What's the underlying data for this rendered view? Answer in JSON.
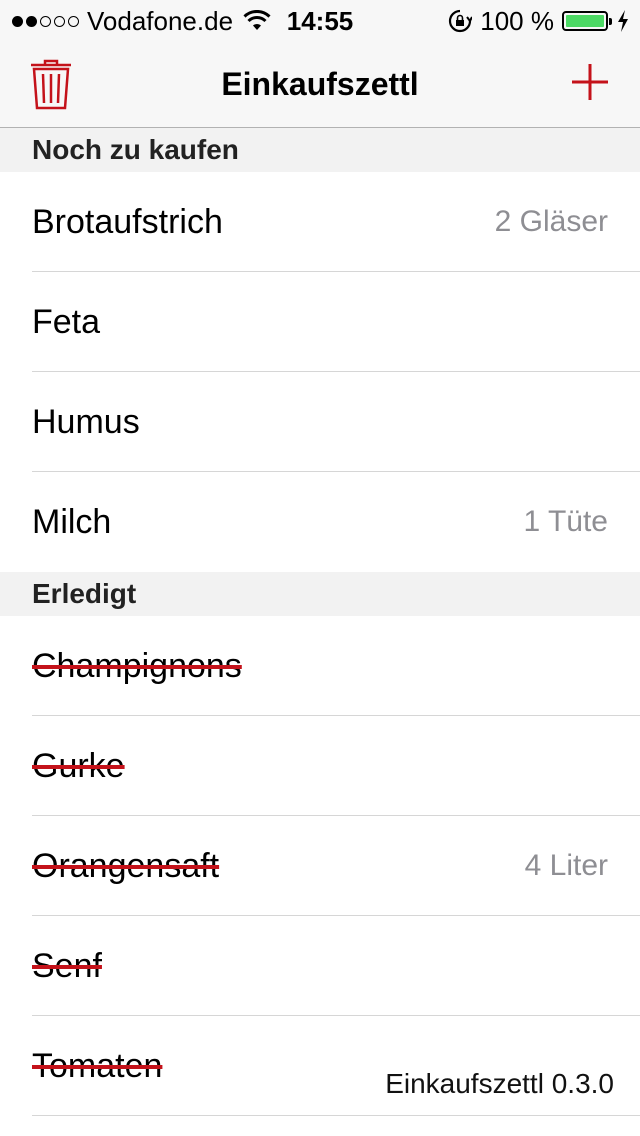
{
  "status_bar": {
    "carrier": "Vodafone.de",
    "signal_bars_filled": 2,
    "signal_bars_total": 5,
    "time": "14:55",
    "battery_percent": "100 %",
    "battery_level": 1.0,
    "battery_color": "#4cd964"
  },
  "navbar": {
    "title": "Einkaufszettl",
    "left_icon": "trash-icon",
    "right_icon": "plus-icon",
    "accent_color": "#c4121a"
  },
  "sections": {
    "pending": {
      "header": "Noch zu kaufen",
      "items": [
        {
          "name": "Brotaufstrich",
          "qty": "2 Gläser"
        },
        {
          "name": "Feta",
          "qty": ""
        },
        {
          "name": "Humus",
          "qty": ""
        },
        {
          "name": "Milch",
          "qty": "1 Tüte"
        }
      ]
    },
    "done": {
      "header": "Erledigt",
      "items": [
        {
          "name": "Champignons",
          "qty": ""
        },
        {
          "name": "Gurke",
          "qty": ""
        },
        {
          "name": "Orangensaft",
          "qty": "4 Liter"
        },
        {
          "name": "Senf",
          "qty": ""
        },
        {
          "name": "Tomaten",
          "qty": ""
        }
      ]
    }
  },
  "footer": {
    "version": "Einkaufszettl 0.3.0"
  }
}
